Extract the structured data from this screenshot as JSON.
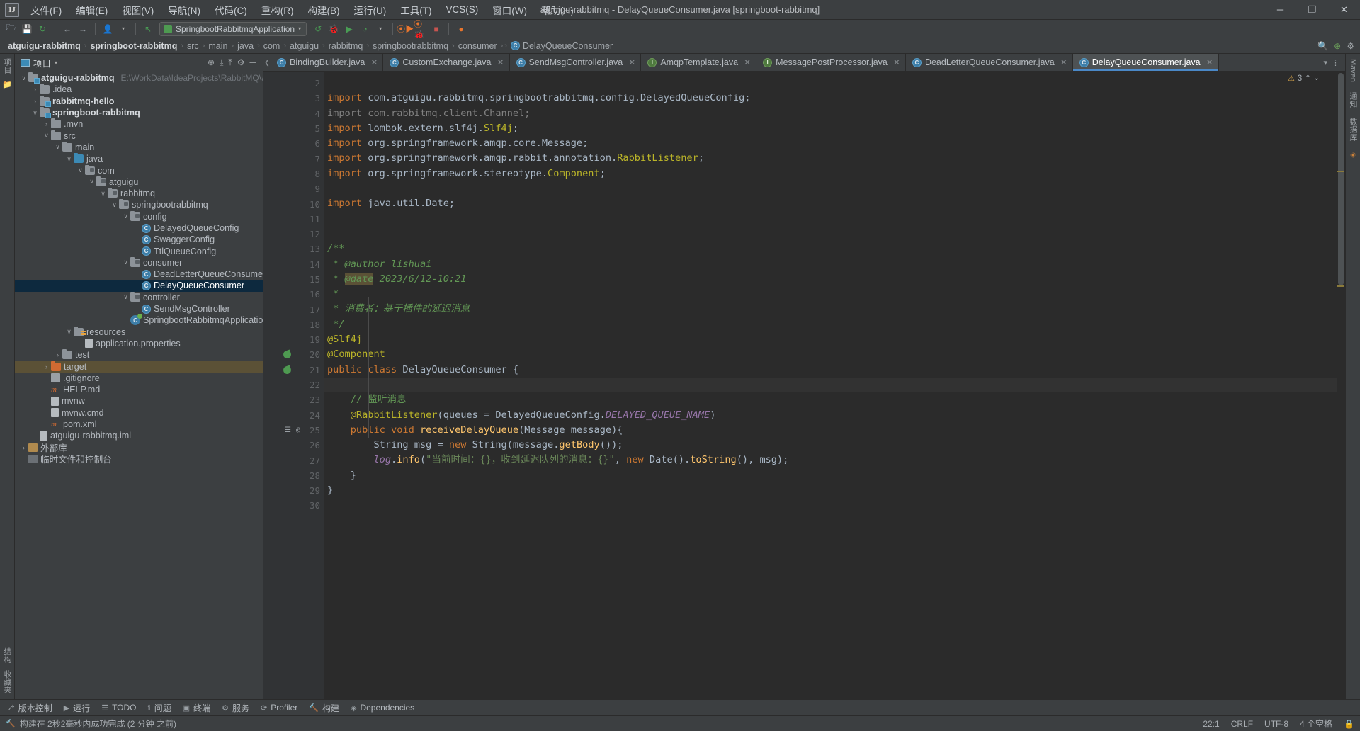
{
  "window": {
    "title": "atguigu-rabbitmq - DelayQueueConsumer.java [springboot-rabbitmq]",
    "logo": "IJ",
    "minimize": "─",
    "maximize": "❐",
    "close": "✕"
  },
  "menubar": [
    {
      "label": "文件(F)",
      "name": "menu-file"
    },
    {
      "label": "编辑(E)",
      "name": "menu-edit"
    },
    {
      "label": "视图(V)",
      "name": "menu-view"
    },
    {
      "label": "导航(N)",
      "name": "menu-navigate"
    },
    {
      "label": "代码(C)",
      "name": "menu-code"
    },
    {
      "label": "重构(R)",
      "name": "menu-refactor"
    },
    {
      "label": "构建(B)",
      "name": "menu-build"
    },
    {
      "label": "运行(U)",
      "name": "menu-run"
    },
    {
      "label": "工具(T)",
      "name": "menu-tools"
    },
    {
      "label": "VCS(S)",
      "name": "menu-vcs"
    },
    {
      "label": "窗口(W)",
      "name": "menu-window"
    },
    {
      "label": "帮助(H)",
      "name": "menu-help"
    }
  ],
  "toolbar": {
    "run_config": "SpringbootRabbitmqApplication",
    "icons": {
      "open": "🗁",
      "save": "💾",
      "sync": "↻",
      "back": "←",
      "forward": "→",
      "profile": "👤",
      "undo": "↖",
      "rerun": "↺",
      "debug": "🐞",
      "run_with": "▶",
      "coverage": "◔",
      "run_app": "▶",
      "debug_app": "🐞",
      "stop": "■",
      "attach": "●"
    }
  },
  "breadcrumb": {
    "items": [
      {
        "label": "atguigu-rabbitmq",
        "bold": true
      },
      {
        "label": "springboot-rabbitmq",
        "bold": true
      },
      {
        "label": "src",
        "bold": false
      },
      {
        "label": "main",
        "bold": false
      },
      {
        "label": "java",
        "bold": false
      },
      {
        "label": "com",
        "bold": false
      },
      {
        "label": "atguigu",
        "bold": false
      },
      {
        "label": "rabbitmq",
        "bold": false
      },
      {
        "label": "springbootrabbitmq",
        "bold": false
      },
      {
        "label": "consumer",
        "bold": false
      }
    ],
    "current_class": "DelayQueueConsumer",
    "separator": "›",
    "search_icon": "🔍",
    "plugin_icon": "⊕",
    "settings_icon": "⚙"
  },
  "left_rail": {
    "project_label": "项目",
    "bookmarks_label": "收藏夹",
    "structure_label": "结构"
  },
  "right_rail": {
    "maven_label": "Maven",
    "notifications_label": "通知",
    "database_label": "数据库",
    "ai_label": "AI"
  },
  "project_panel": {
    "title": "项目",
    "dropdown": "▾",
    "tools": {
      "locate": "⊕",
      "expand": "⤓",
      "collapse": "⤒",
      "settings": "⚙",
      "hide": "─"
    },
    "tree": [
      {
        "indent": 0,
        "arrow": "v",
        "icon": "folder-mod",
        "label": "atguigu-rabbitmq",
        "bold": true,
        "path": "E:\\WorkData\\IdeaProjects\\RabbitMQ\\at",
        "name": "tree-node-atguigu-rabbitmq"
      },
      {
        "indent": 1,
        "arrow": ">",
        "icon": "folder",
        "label": ".idea",
        "bold": false,
        "name": "tree-node-idea"
      },
      {
        "indent": 1,
        "arrow": ">",
        "icon": "folder-mod",
        "label": "rabbitmq-hello",
        "bold": true,
        "name": "tree-node-rabbitmq-hello"
      },
      {
        "indent": 1,
        "arrow": "v",
        "icon": "folder-mod",
        "label": "springboot-rabbitmq",
        "bold": true,
        "name": "tree-node-springboot-rabbitmq"
      },
      {
        "indent": 2,
        "arrow": ">",
        "icon": "folder",
        "label": ".mvn",
        "bold": false,
        "name": "tree-node-mvn"
      },
      {
        "indent": 2,
        "arrow": "v",
        "icon": "folder",
        "label": "src",
        "bold": false,
        "name": "tree-node-src"
      },
      {
        "indent": 3,
        "arrow": "v",
        "icon": "folder",
        "label": "main",
        "bold": false,
        "name": "tree-node-main"
      },
      {
        "indent": 4,
        "arrow": "v",
        "icon": "folder-src",
        "label": "java",
        "bold": false,
        "name": "tree-node-java"
      },
      {
        "indent": 5,
        "arrow": "v",
        "icon": "folder-pkg",
        "label": "com",
        "bold": false,
        "name": "tree-node-com"
      },
      {
        "indent": 6,
        "arrow": "v",
        "icon": "folder-pkg",
        "label": "atguigu",
        "bold": false,
        "name": "tree-node-atguigu"
      },
      {
        "indent": 7,
        "arrow": "v",
        "icon": "folder-pkg",
        "label": "rabbitmq",
        "bold": false,
        "name": "tree-node-rabbitmq"
      },
      {
        "indent": 8,
        "arrow": "v",
        "icon": "folder-pkg",
        "label": "springbootrabbitmq",
        "bold": false,
        "name": "tree-node-springbootrabbitmq"
      },
      {
        "indent": 9,
        "arrow": "v",
        "icon": "folder-pkg",
        "label": "config",
        "bold": false,
        "name": "tree-node-config"
      },
      {
        "indent": 10,
        "arrow": "",
        "icon": "class",
        "label": "DelayedQueueConfig",
        "bold": false,
        "name": "tree-node-delayedqueueconfig"
      },
      {
        "indent": 10,
        "arrow": "",
        "icon": "class",
        "label": "SwaggerConfig",
        "bold": false,
        "name": "tree-node-swaggerconfig"
      },
      {
        "indent": 10,
        "arrow": "",
        "icon": "class",
        "label": "TtlQueueConfig",
        "bold": false,
        "name": "tree-node-ttlqueueconfig"
      },
      {
        "indent": 9,
        "arrow": "v",
        "icon": "folder-pkg",
        "label": "consumer",
        "bold": false,
        "name": "tree-node-consumer"
      },
      {
        "indent": 10,
        "arrow": "",
        "icon": "class",
        "label": "DeadLetterQueueConsumer",
        "bold": false,
        "name": "tree-node-deadletterqueueconsumer"
      },
      {
        "indent": 10,
        "arrow": "",
        "icon": "class",
        "label": "DelayQueueConsumer",
        "bold": false,
        "selected": true,
        "name": "tree-node-delayqueueconsumer"
      },
      {
        "indent": 9,
        "arrow": "v",
        "icon": "folder-pkg",
        "label": "controller",
        "bold": false,
        "name": "tree-node-controller"
      },
      {
        "indent": 10,
        "arrow": "",
        "icon": "class",
        "label": "SendMsgController",
        "bold": false,
        "name": "tree-node-sendmsgcontroller"
      },
      {
        "indent": 9,
        "arrow": "",
        "icon": "spring",
        "label": "SpringbootRabbitmqApplication",
        "bold": false,
        "name": "tree-node-springbootrabbitmqapplication"
      },
      {
        "indent": 4,
        "arrow": "v",
        "icon": "folder-res",
        "label": "resources",
        "bold": false,
        "name": "tree-node-resources"
      },
      {
        "indent": 5,
        "arrow": "",
        "icon": "doc",
        "label": "application.properties",
        "bold": false,
        "name": "tree-node-application-properties"
      },
      {
        "indent": 3,
        "arrow": ">",
        "icon": "folder",
        "label": "test",
        "bold": false,
        "name": "tree-node-test"
      },
      {
        "indent": 2,
        "arrow": ">",
        "icon": "folder-target",
        "label": "target",
        "bold": false,
        "highlight": true,
        "name": "tree-node-target"
      },
      {
        "indent": 2,
        "arrow": "",
        "icon": "git",
        "label": ".gitignore",
        "bold": false,
        "name": "tree-node-gitignore"
      },
      {
        "indent": 2,
        "arrow": "",
        "icon": "md",
        "label": "HELP.md",
        "bold": false,
        "name": "tree-node-help-md"
      },
      {
        "indent": 2,
        "arrow": "",
        "icon": "doc",
        "label": "mvnw",
        "bold": false,
        "name": "tree-node-mvnw"
      },
      {
        "indent": 2,
        "arrow": "",
        "icon": "doc",
        "label": "mvnw.cmd",
        "bold": false,
        "name": "tree-node-mvnw-cmd"
      },
      {
        "indent": 2,
        "arrow": "",
        "icon": "md",
        "label": "pom.xml",
        "bold": false,
        "name": "tree-node-pom-xml"
      },
      {
        "indent": 1,
        "arrow": "",
        "icon": "doc",
        "label": "atguigu-rabbitmq.iml",
        "bold": false,
        "name": "tree-node-iml"
      },
      {
        "indent": 0,
        "arrow": ">",
        "icon": "lib",
        "label": "外部库",
        "bold": false,
        "name": "tree-node-external-libraries"
      },
      {
        "indent": 0,
        "arrow": "",
        "icon": "term",
        "label": "临时文件和控制台",
        "bold": false,
        "name": "tree-node-scratches"
      }
    ]
  },
  "editor": {
    "tabs": [
      {
        "label": "BindingBuilder.java",
        "icon": "class",
        "active": false,
        "name": "tab-bindingbuilder"
      },
      {
        "label": "CustomExchange.java",
        "icon": "class",
        "active": false,
        "name": "tab-customexchange"
      },
      {
        "label": "SendMsgController.java",
        "icon": "class",
        "active": false,
        "name": "tab-sendmsgcontroller"
      },
      {
        "label": "AmqpTemplate.java",
        "icon": "interface",
        "active": false,
        "name": "tab-amqptemplate"
      },
      {
        "label": "MessagePostProcessor.java",
        "icon": "interface",
        "active": false,
        "name": "tab-messagepostprocessor"
      },
      {
        "label": "DeadLetterQueueConsumer.java",
        "icon": "class",
        "active": false,
        "name": "tab-deadletterqueueconsumer"
      },
      {
        "label": "DelayQueueConsumer.java",
        "icon": "class",
        "active": true,
        "name": "tab-delayqueueconsumer"
      }
    ],
    "inspection": {
      "count": "3",
      "icon": "⚠",
      "up": "⌃",
      "down": "⌄"
    },
    "first_line": 2,
    "lines": [
      {
        "n": 2,
        "html": ""
      },
      {
        "n": 3,
        "html": "<span class=\"kw\">import</span> <span class=\"id\">com.atguigu.rabbitmq.springbootrabbitmq.config.</span><span class=\"typ\">DelayedQueueConfig</span><span class=\"id\">;</span>",
        "fold": "minus"
      },
      {
        "n": 4,
        "html": "<span class=\"grey\">import com.rabbitmq.client.Channel;</span>"
      },
      {
        "n": 5,
        "html": "<span class=\"kw\">import</span> <span class=\"id\">lombok.extern.slf4j.</span><span class=\"ann-y\">Slf4j</span><span class=\"id\">;</span>"
      },
      {
        "n": 6,
        "html": "<span class=\"kw\">import</span> <span class=\"id\">org.springframework.amqp.core.</span><span class=\"typ\">Message</span><span class=\"id\">;</span>"
      },
      {
        "n": 7,
        "html": "<span class=\"kw\">import</span> <span class=\"id\">org.springframework.amqp.rabbit.annotation.</span><span class=\"ann-y\">RabbitListener</span><span class=\"id\">;</span>"
      },
      {
        "n": 8,
        "html": "<span class=\"kw\">import</span> <span class=\"id\">org.springframework.stereotype.</span><span class=\"ann-y\">Component</span><span class=\"id\">;</span>"
      },
      {
        "n": 9,
        "html": ""
      },
      {
        "n": 10,
        "html": "<span class=\"kw\">import</span> <span class=\"id\">java.util.</span><span class=\"typ\">Date</span><span class=\"id\">;</span>",
        "fold": "minus"
      },
      {
        "n": 11,
        "html": ""
      },
      {
        "n": 12,
        "html": ""
      },
      {
        "n": 13,
        "html": "<span class=\"cmt\">/**</span>",
        "fold": "minus"
      },
      {
        "n": 14,
        "html": "<span class=\"cmt\"> * </span><span class=\"tag-link\">@author</span><span class=\"cmt\"> lishuai</span>"
      },
      {
        "n": 15,
        "html": "<span class=\"cmt\"> * </span><span class=\"tag-hl\">@date</span><span class=\"cmt\"> 2023/6/12-10:21</span>"
      },
      {
        "n": 16,
        "html": "<span class=\"cmt\"> *</span>"
      },
      {
        "n": 17,
        "html": "<span class=\"cmt\"> * 消费者：基于插件的延迟消息</span>"
      },
      {
        "n": 18,
        "html": "<span class=\"cmt\"> */</span>",
        "fold": "end"
      },
      {
        "n": 19,
        "html": "<span class=\"ann-y\">@Slf4j</span>",
        "fold": "minus"
      },
      {
        "n": 20,
        "html": "<span class=\"ann-y\">@Component</span>",
        "fold": "minus",
        "glyph": "bean"
      },
      {
        "n": 21,
        "html": "<span class=\"kw\">public class </span><span class=\"typ\">DelayQueueConsumer</span><span class=\"id\"> {</span>",
        "glyph": "bean"
      },
      {
        "n": 22,
        "html": "    <span class=\"caret-bar\"></span>",
        "current": true
      },
      {
        "n": 23,
        "html": "    <span class=\"lcmt\">// 监听消息</span>"
      },
      {
        "n": 24,
        "html": "    <span class=\"ann-y\">@RabbitListener</span><span class=\"id\">(queues = </span><span class=\"typ\">DelayedQueueConfig.</span><span class=\"stat-const\">DELAYED_QUEUE_NAME</span><span class=\"id\">)</span>"
      },
      {
        "n": 25,
        "html": "    <span class=\"kw\">public void </span><span class=\"mth\">receiveDelayQueue</span><span class=\"id\">(</span><span class=\"typ\">Message</span><span class=\"id\"> message){</span>",
        "ann": "@",
        "fold": "minus",
        "glyph": "override"
      },
      {
        "n": 26,
        "html": "        <span class=\"typ\">String</span><span class=\"id\"> msg = </span><span class=\"kw\">new </span><span class=\"typ\">String</span><span class=\"id\">(message.</span><span class=\"mth\">getBody</span><span class=\"id\">());</span>"
      },
      {
        "n": 27,
        "html": "        <span class=\"fld\"><i>log</i></span><span class=\"id\">.</span><span class=\"mth\">info</span><span class=\"id\">(</span><span class=\"str\">\"当前时间：{}，收到延迟队列的消息：{}\"</span><span class=\"id\">, </span><span class=\"kw\">new </span><span class=\"typ\">Date</span><span class=\"id\">().</span><span class=\"mth\">toString</span><span class=\"id\">(), msg);</span>"
      },
      {
        "n": 28,
        "html": "    <span class=\"id\">}</span>",
        "fold": "end"
      },
      {
        "n": 29,
        "html": "<span class=\"id\">}</span>"
      },
      {
        "n": 30,
        "html": ""
      }
    ]
  },
  "toolwindows": [
    {
      "label": "版本控制",
      "icon": "⎇",
      "name": "toolwindow-version-control"
    },
    {
      "label": "运行",
      "icon": "▶",
      "name": "toolwindow-run"
    },
    {
      "label": "TODO",
      "icon": "☰",
      "name": "toolwindow-todo"
    },
    {
      "label": "问题",
      "icon": "ℹ",
      "name": "toolwindow-problems"
    },
    {
      "label": "终端",
      "icon": "▣",
      "name": "toolwindow-terminal"
    },
    {
      "label": "服务",
      "icon": "⚙",
      "name": "toolwindow-services"
    },
    {
      "label": "Profiler",
      "icon": "⟳",
      "name": "toolwindow-profiler"
    },
    {
      "label": "构建",
      "icon": "🔨",
      "name": "toolwindow-build"
    },
    {
      "label": "Dependencies",
      "icon": "◈",
      "name": "toolwindow-dependencies"
    }
  ],
  "statusbar": {
    "message": "构建在 2秒2毫秒内成功完成 (2 分钟 之前)",
    "icon": "🔨",
    "caret_position": "22:1",
    "line_separator": "CRLF",
    "encoding": "UTF-8",
    "indent": "4 个空格",
    "lock_icon": "🔒"
  }
}
